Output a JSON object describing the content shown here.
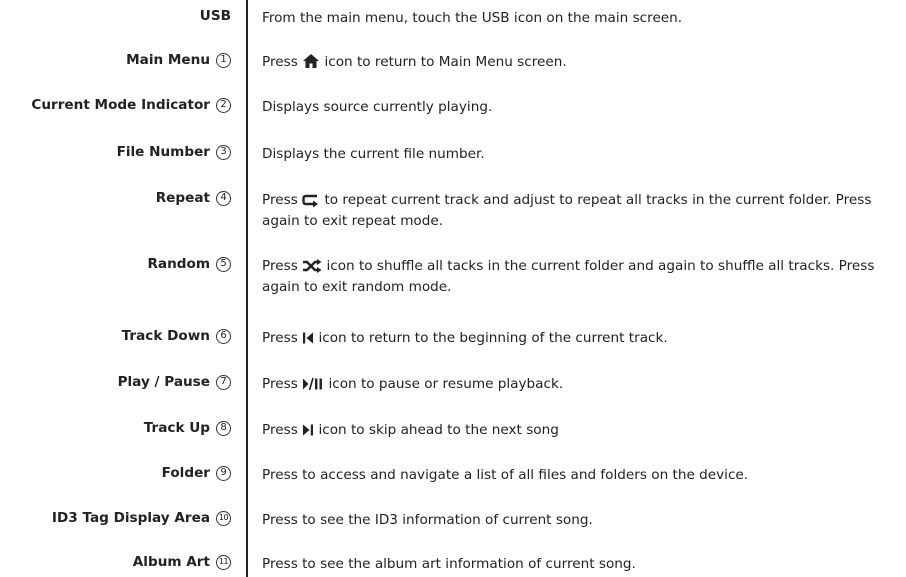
{
  "rows": [
    {
      "label": "USB",
      "num": "",
      "text": "From the main menu, touch the USB icon on the main screen."
    },
    {
      "label": "Main Menu",
      "num": "1",
      "pre": "Press",
      "post": "icon to return to Main Menu screen.",
      "icon": "home-icon"
    },
    {
      "label": "Current Mode Indicator",
      "num": "2",
      "text": "Displays source currently playing."
    },
    {
      "label": "File Number",
      "num": "3",
      "text": "Displays the current file number."
    },
    {
      "label": "Repeat",
      "num": "4",
      "pre": "Press",
      "post": "to repeat current track and adjust to repeat all tracks in the current folder. Press again to exit repeat mode.",
      "icon": "repeat-icon"
    },
    {
      "label": "Random",
      "num": "5",
      "pre": "Press",
      "post": "icon to shuffle all tacks in the current folder and again to shuffle all tracks. Press again to exit random mode.",
      "icon": "shuffle-icon"
    },
    {
      "label": "Track Down",
      "num": "6",
      "pre": "Press",
      "post": "icon to return to the beginning of the current track.",
      "icon": "track-down-icon"
    },
    {
      "label": "Play / Pause",
      "num": "7",
      "pre": "Press",
      "post": "icon to pause or resume playback.",
      "icon": "play-pause-icon"
    },
    {
      "label": "Track Up",
      "num": "8",
      "pre": "Press",
      "post": "icon to skip ahead to the next song",
      "icon": "track-up-icon"
    },
    {
      "label": "Folder",
      "num": "9",
      "text": "Press to access and navigate a list of all files and folders on the device."
    },
    {
      "label": "ID3 Tag Display Area",
      "num": "10",
      "text": "Press to see the ID3 information of current song."
    },
    {
      "label": "Album Art",
      "num": "11",
      "text": "Press to see the album art information of current song."
    }
  ]
}
